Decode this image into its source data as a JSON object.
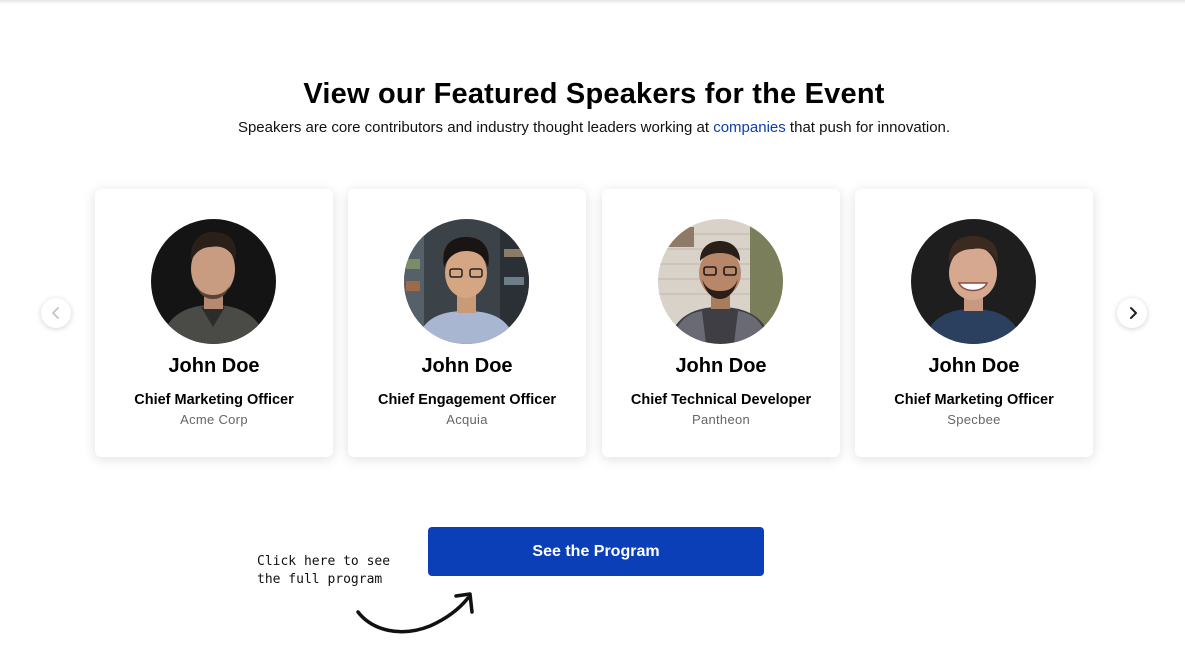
{
  "header": {
    "title": "View our Featured Speakers for the Event",
    "subtitle_before": "Speakers are core contributors and industry thought leaders working at ",
    "subtitle_link": "companies",
    "subtitle_after": " that push for innovation."
  },
  "carousel": {
    "prev_icon": "chevron-left-icon",
    "next_icon": "chevron-right-icon",
    "speakers": [
      {
        "name": "John Doe",
        "role": "Chief Marketing Officer",
        "company": "Acme Corp"
      },
      {
        "name": "John Doe",
        "role": "Chief Engagement Officer",
        "company": "Acquia"
      },
      {
        "name": "John Doe",
        "role": "Chief Technical Developer",
        "company": "Pantheon"
      },
      {
        "name": "John Doe",
        "role": "Chief Marketing Officer",
        "company": "Specbee"
      }
    ]
  },
  "cta": {
    "button_label": "See the Program",
    "hint_line1": "Click here to see",
    "hint_line2": "the full program"
  },
  "colors": {
    "accent": "#0b3fb8",
    "link": "#0b3fb0"
  }
}
